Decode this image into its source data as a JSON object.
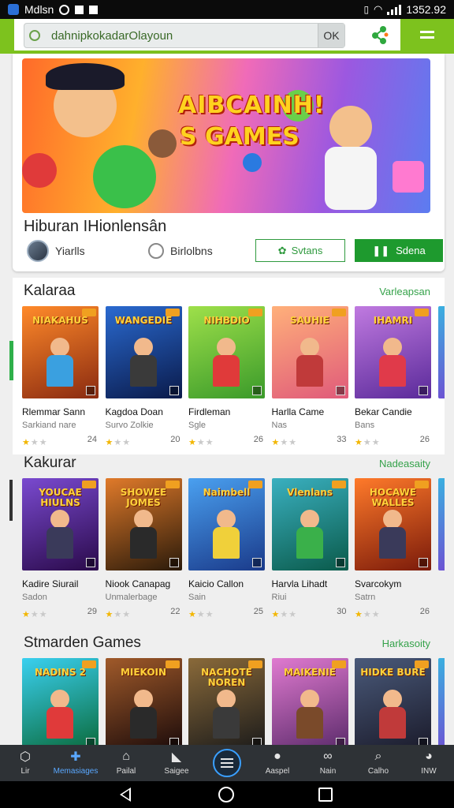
{
  "status_bar": {
    "app_name": "Mdlsn",
    "time": "1352.92"
  },
  "search": {
    "value": "dahnipkokadar",
    "placeholder": "Olayoun",
    "clear_label": "OK"
  },
  "hero": {
    "banner_line1": "AIBCAINH!",
    "banner_line2": "S GAMES",
    "title": "Hiburan IHionlensân",
    "user1": "Yiarlls",
    "user2": "Birlolbns",
    "btn_outline": "Svtans",
    "btn_filled": "Sdena"
  },
  "sections": [
    {
      "title": "Kalaraa",
      "more": "Varleapsan",
      "cards": [
        {
          "art": "NIAKAHUS",
          "name": "Rlemmar Sann",
          "sub": "Sarkiand nare",
          "rating": 1,
          "count": "24",
          "c1": "#ff8a2a",
          "c2": "#8a2a10",
          "body": "#3aa0e0"
        },
        {
          "art": "WANGEDIE",
          "name": "Kagdoa Doan",
          "sub": "Survo Zolkie",
          "rating": 1,
          "count": "20",
          "c1": "#2a6ad0",
          "c2": "#0a1a4a",
          "body": "#3a3a3a"
        },
        {
          "art": "NIHBDIO",
          "name": "Firdleman",
          "sub": "Sgle",
          "rating": 1,
          "count": "26",
          "c1": "#9ee04a",
          "c2": "#3a9a2a",
          "body": "#e03a3a"
        },
        {
          "art": "SAUHIE",
          "name": "Harlla Came",
          "sub": "Nas",
          "rating": 1,
          "count": "33",
          "c1": "#ffb07a",
          "c2": "#e05a7a",
          "body": "#c03a3a"
        },
        {
          "art": "IHAMRI",
          "name": "Bekar Candie",
          "sub": "Bans",
          "rating": 1,
          "count": "26",
          "c1": "#c07ae0",
          "c2": "#5a2a9a",
          "body": "#e03a4a"
        }
      ]
    },
    {
      "title": "Kakurar",
      "more": "Nadeasaity",
      "cards": [
        {
          "art": "YOUCAE HIULNS",
          "name": "Kadire Siurail",
          "sub": "Sadon",
          "rating": 1,
          "count": "29",
          "c1": "#7a4ad0",
          "c2": "#2a0a4a",
          "body": "#3a3a5a"
        },
        {
          "art": "SHOWEE JOMES",
          "name": "Niook Canapag",
          "sub": "Unmalerbage",
          "rating": 1,
          "count": "22",
          "c1": "#e07a2a",
          "c2": "#2a1a0a",
          "body": "#2a2a2a"
        },
        {
          "art": "Naimbell",
          "name": "Kaicio Callon",
          "sub": "Sain",
          "rating": 1,
          "count": "25",
          "c1": "#4aa0f0",
          "c2": "#1a3a8a",
          "body": "#f0d03a"
        },
        {
          "art": "Vlenlans",
          "name": "Harvla Lihadt",
          "sub": "Riui",
          "rating": 1,
          "count": "30",
          "c1": "#3ab0c0",
          "c2": "#0a5a4a",
          "body": "#3ab04a"
        },
        {
          "art": "HOCAWE WALLES",
          "name": "Svarcokym",
          "sub": "Satrn",
          "rating": 1,
          "count": "26",
          "c1": "#ff7a2a",
          "c2": "#7a1a0a",
          "body": "#3a3a5a"
        }
      ]
    },
    {
      "title": "Stmarden Games",
      "more": "Harkasoity",
      "cards": [
        {
          "art": "NADINS 2",
          "name": "",
          "sub": "",
          "rating": 1,
          "count": "",
          "c1": "#3ad0f0",
          "c2": "#0a6a3a",
          "body": "#e03a3a"
        },
        {
          "art": "MIEKOIN",
          "name": "",
          "sub": "",
          "rating": 1,
          "count": "",
          "c1": "#a05a2a",
          "c2": "#1a0a0a",
          "body": "#2a2a2a"
        },
        {
          "art": "NACHOTE NOREN",
          "name": "",
          "sub": "",
          "rating": 1,
          "count": "",
          "c1": "#8a6a3a",
          "c2": "#1a1a1a",
          "body": "#3a3a3a"
        },
        {
          "art": "MAIKENIE",
          "name": "",
          "sub": "",
          "rating": 1,
          "count": "",
          "c1": "#e07ad0",
          "c2": "#5a2a6a",
          "body": "#7a4a2a"
        },
        {
          "art": "HIDKE BURE",
          "name": "",
          "sub": "",
          "rating": 1,
          "count": "",
          "c1": "#4a5a7a",
          "c2": "#1a1a2a",
          "body": "#c03a3a"
        }
      ]
    }
  ],
  "bottom_nav": [
    {
      "label": "Lir",
      "icon": "shield-icon"
    },
    {
      "label": "Memasiages",
      "icon": "puzzle-icon",
      "active": true
    },
    {
      "label": "Pailal",
      "icon": "home-icon"
    },
    {
      "label": "Saigee",
      "icon": "tag-icon"
    },
    {
      "label": "",
      "icon": "menu-icon",
      "center": true
    },
    {
      "label": "Aaspel",
      "icon": "ball-icon"
    },
    {
      "label": "Nain",
      "icon": "glasses-icon"
    },
    {
      "label": "Calho",
      "icon": "search-icon"
    },
    {
      "label": "INW",
      "icon": "profile-icon"
    }
  ],
  "colors": {
    "accent": "#7dc21e",
    "primary_green": "#1e9a2e",
    "link_green": "#35a24a",
    "nav_bg": "#2e3236",
    "active_nav": "#5aa8ff"
  }
}
